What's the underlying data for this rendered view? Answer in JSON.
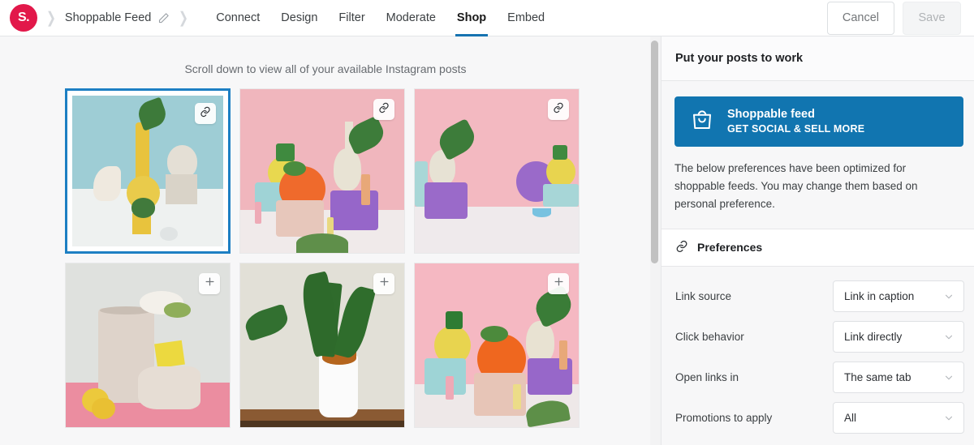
{
  "brand": {
    "logo_text": "S.",
    "logo_color": "#e2184a"
  },
  "breadcrumb": {
    "title": "Shoppable Feed",
    "edit_icon": "pencil-icon",
    "chevron_icon": "chevron-right-icon"
  },
  "tabs": [
    {
      "label": "Connect",
      "active": false
    },
    {
      "label": "Design",
      "active": false
    },
    {
      "label": "Filter",
      "active": false
    },
    {
      "label": "Moderate",
      "active": false
    },
    {
      "label": "Shop",
      "active": true
    },
    {
      "label": "Embed",
      "active": false
    }
  ],
  "tab_accent_color": "#1673b1",
  "actions": {
    "cancel_label": "Cancel",
    "save_label": "Save"
  },
  "main": {
    "scroll_hint": "Scroll down to view all of your available Instagram posts",
    "tiles": [
      {
        "badge_icon": "link-icon",
        "selected": true,
        "alt": "yellow vases with plants on blue background"
      },
      {
        "badge_icon": "link-icon",
        "selected": false,
        "alt": "orange and yellow fruit vases on pink background"
      },
      {
        "badge_icon": "link-icon",
        "selected": false,
        "alt": "white vase on purple pedestal pink background"
      },
      {
        "badge_icon": "plus-icon",
        "selected": false,
        "alt": "beige vase with flowers and lemons"
      },
      {
        "badge_icon": "plus-icon",
        "selected": false,
        "alt": "zz plant in white pot"
      },
      {
        "badge_icon": "plus-icon",
        "selected": false,
        "alt": "orange and yellow fruit vases pink background"
      }
    ]
  },
  "panel": {
    "header": "Put your posts to work",
    "promo": {
      "icon": "shopping-bag-icon",
      "title": "Shoppable feed",
      "subtitle": "GET SOCIAL & SELL MORE",
      "color": "#1175b0"
    },
    "description": "The below preferences have been optimized for shoppable feeds. You may change them based on personal preference.",
    "preferences": {
      "icon": "link-icon",
      "title": "Preferences",
      "rows": [
        {
          "label": "Link source",
          "value": "Link in caption"
        },
        {
          "label": "Click behavior",
          "value": "Link directly"
        },
        {
          "label": "Open links in",
          "value": "The same tab"
        },
        {
          "label": "Promotions to apply",
          "value": "All"
        }
      ]
    }
  }
}
